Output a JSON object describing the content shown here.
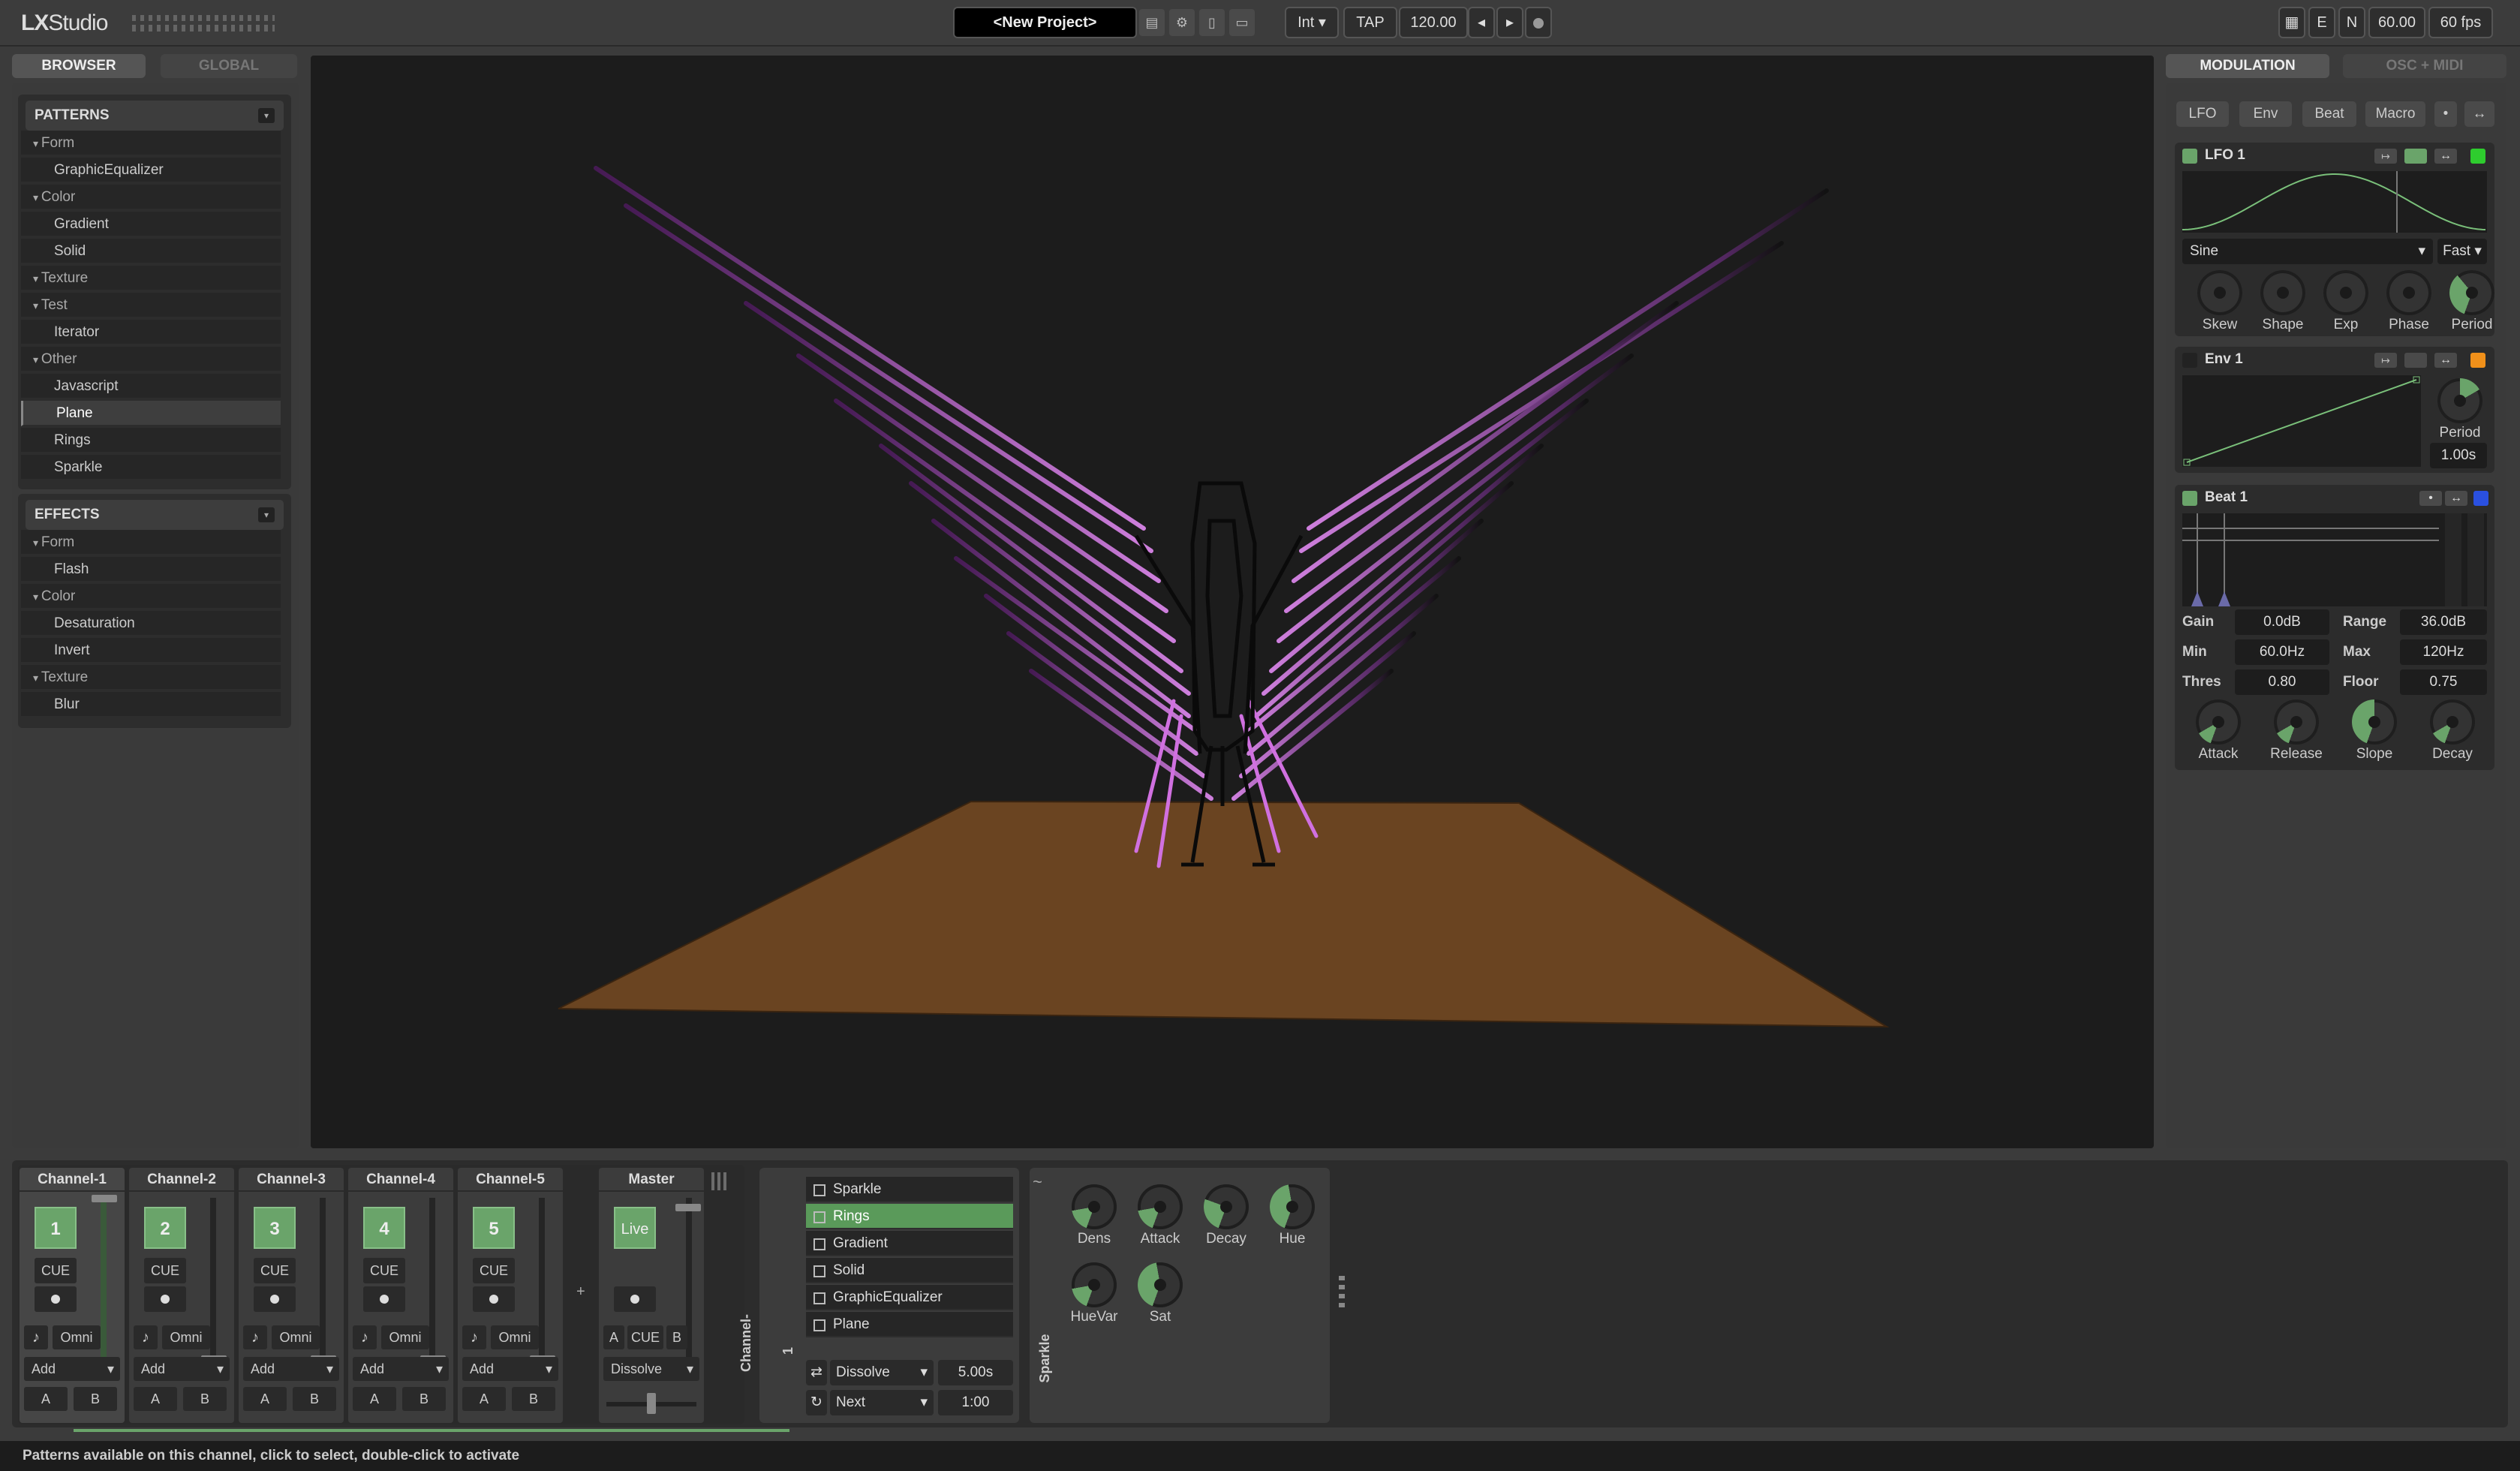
{
  "app": {
    "logo_lx": "LX",
    "logo_studio": "Studio"
  },
  "toolbar": {
    "project": "<New Project>",
    "tempo_mode": "Int",
    "tap": "TAP",
    "bpm": "120.00",
    "prev": "◂",
    "next": "▸",
    "e": "E",
    "n": "N",
    "fps_value": "60.00",
    "fps": "60 fps"
  },
  "left": {
    "tab_browser": "BROWSER",
    "tab_global": "GLOBAL"
  },
  "patterns": {
    "title": "PATTERNS",
    "rows": [
      {
        "label": "Form",
        "group": true
      },
      {
        "label": "GraphicEqualizer"
      },
      {
        "label": "Color",
        "group": true
      },
      {
        "label": "Gradient"
      },
      {
        "label": "Solid"
      },
      {
        "label": "Texture",
        "group": true
      },
      {
        "label": "Test",
        "group": true
      },
      {
        "label": "Iterator"
      },
      {
        "label": "Other",
        "group": true
      },
      {
        "label": "Javascript"
      },
      {
        "label": "Plane",
        "selected": true
      },
      {
        "label": "Rings"
      },
      {
        "label": "Sparkle"
      }
    ]
  },
  "effects": {
    "title": "EFFECTS",
    "rows": [
      {
        "label": "Form",
        "group": true
      },
      {
        "label": "Flash"
      },
      {
        "label": "Color",
        "group": true
      },
      {
        "label": "Desaturation"
      },
      {
        "label": "Invert"
      },
      {
        "label": "Texture",
        "group": true
      },
      {
        "label": "Blur"
      }
    ]
  },
  "right": {
    "tab_modulation": "MODULATION",
    "tab_osc": "OSC + MIDI",
    "buttons": [
      "LFO",
      "Env",
      "Beat",
      "Macro"
    ]
  },
  "lfo": {
    "title": "LFO 1",
    "wave": "Sine",
    "speed": "Fast",
    "knobs": [
      "Skew",
      "Shape",
      "Exp",
      "Phase",
      "Period"
    ],
    "color": "#2ecc2e"
  },
  "env": {
    "title": "Env 1",
    "period_label": "Period",
    "period": "1.00s",
    "color": "#f0901a"
  },
  "beat": {
    "title": "Beat 1",
    "color": "#2a50e0",
    "gain_label": "Gain",
    "gain": "0.0dB",
    "range_label": "Range",
    "range": "36.0dB",
    "min_label": "Min",
    "min": "60.0Hz",
    "max_label": "Max",
    "max": "120Hz",
    "thres_label": "Thres",
    "thres": "0.80",
    "floor_label": "Floor",
    "floor": "0.75",
    "knobs": [
      "Attack",
      "Release",
      "Slope",
      "Decay"
    ]
  },
  "mixer": {
    "channels": [
      {
        "name": "Channel-1",
        "num": "1"
      },
      {
        "name": "Channel-2",
        "num": "2"
      },
      {
        "name": "Channel-3",
        "num": "3"
      },
      {
        "name": "Channel-4",
        "num": "4"
      },
      {
        "name": "Channel-5",
        "num": "5"
      }
    ],
    "cue": "CUE",
    "omni": "Omni",
    "add": "Add",
    "a": "A",
    "b": "B",
    "master": "Master",
    "live": "Live",
    "dissolve": "Dissolve",
    "plus": "+"
  },
  "channel_patterns": {
    "vertical_label": "Channel-1",
    "items": [
      "Sparkle",
      "Rings",
      "Gradient",
      "Solid",
      "GraphicEqualizer",
      "Plane"
    ],
    "selected": "Rings",
    "transition": "Dissolve",
    "transition_time": "5.00s",
    "mode": "Next",
    "mode_time": "1:00"
  },
  "device": {
    "vertical_label": "Sparkle",
    "knobs": [
      "Dens",
      "Attack",
      "Decay",
      "Hue",
      "HueVar",
      "Sat"
    ]
  },
  "status": "Patterns available on this channel, click to select, double-click to activate"
}
